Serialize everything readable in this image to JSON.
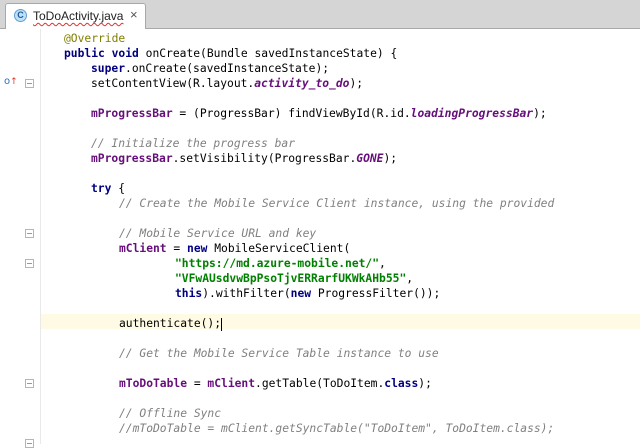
{
  "tab": {
    "icon_letter": "C",
    "title": "ToDoActivity.java",
    "close": "×"
  },
  "gutter": {
    "override_marker": "o",
    "override_arrow": "↑"
  },
  "code": {
    "l1": {
      "a": "@Override"
    },
    "l2": {
      "a": "public",
      "b": " ",
      "c": "void",
      "d": " onCreate(Bundle savedInstanceState) {"
    },
    "l3": {
      "a": "super",
      "b": ".onCreate(savedInstanceState);"
    },
    "l4": {
      "a": "setContentView(R.layout.",
      "b": "activity_to_do",
      "c": ");"
    },
    "l5": {
      "a": "mProgressBar",
      "b": " = (ProgressBar) findViewById(R.id.",
      "c": "loadingProgressBar",
      "d": ");"
    },
    "l6": {
      "a": "// Initialize the progress bar"
    },
    "l7": {
      "a": "mProgressBar",
      "b": ".setVisibility(ProgressBar.",
      "c": "GONE",
      "d": ");"
    },
    "l8": {
      "a": "try",
      "b": " {"
    },
    "l9": {
      "a": "// Create the Mobile Service Client instance, using the provided"
    },
    "l10": {
      "a": "// Mobile Service URL and key"
    },
    "l11": {
      "a": "mClient",
      "b": " = ",
      "c": "new",
      "d": " MobileServiceClient("
    },
    "l12": {
      "a": "\"https://md.azure-mobile.net/\"",
      "b": ","
    },
    "l13": {
      "a": "\"VFwAUsdvwBpPsoTjvERRarfUKWkAHb55\"",
      "b": ","
    },
    "l14": {
      "a": "this",
      "b": ").withFilter(",
      "c": "new",
      "d": " ProgressFilter());"
    },
    "l15": {
      "a": "authenticate();"
    },
    "l16": {
      "a": "// Get the Mobile Service Table instance to use"
    },
    "l17": {
      "a": "mToDoTable",
      "b": " = ",
      "c": "mClient",
      "d": ".getTable(ToDoItem.",
      "e": "class",
      "f": ");"
    },
    "l18": {
      "a": "// Offline Sync"
    },
    "l19": {
      "a": "//mToDoTable = mClient.getSyncTable(\"ToDoItem\", ToDoItem.class);"
    }
  }
}
